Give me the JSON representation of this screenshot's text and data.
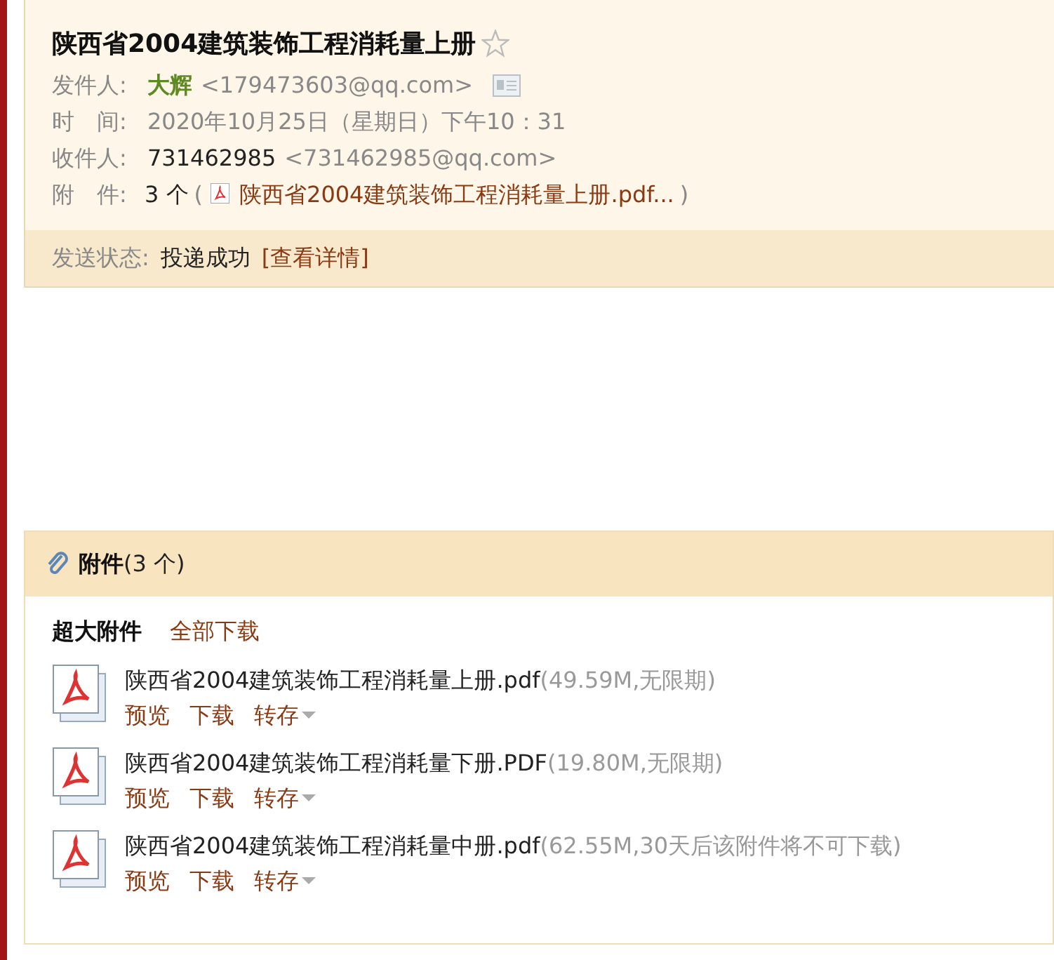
{
  "header": {
    "subject": "陕西省2004建筑装饰工程消耗量上册",
    "fields": [
      {
        "kind": "sender",
        "label": "发件人:",
        "name": "大辉",
        "address": "<179473603@qq.com>"
      },
      {
        "kind": "plain",
        "label": "时　间:",
        "value": "2020年10月25日（星期日）下午10：31"
      },
      {
        "kind": "recipient",
        "label": "收件人:",
        "name": "731462985",
        "address": "<731462985@qq.com>"
      },
      {
        "kind": "attachment",
        "label": "附　件:",
        "count": "3 个",
        "open": "(",
        "file": "陕西省2004建筑装饰工程消耗量上册.pdf...",
        "close": ")"
      }
    ],
    "status": {
      "label": "发送状态:",
      "value": "投递成功",
      "link": "[查看详情]"
    }
  },
  "attachments": {
    "title": "附件",
    "count": "(3 个)",
    "group": "超大附件",
    "download_all": "全部下载",
    "files": [
      {
        "name": "陕西省2004建筑装饰工程消耗量上册.pdf",
        "info": "(49.59M,无限期)",
        "actions": [
          "预览",
          "下载",
          "转存"
        ]
      },
      {
        "name": "陕西省2004建筑装饰工程消耗量下册.PDF",
        "info": "(19.80M,无限期)",
        "actions": [
          "预览",
          "下载",
          "转存"
        ]
      },
      {
        "name": "陕西省2004建筑装饰工程消耗量中册.pdf",
        "info": "(62.55M,30天后该附件将不可下载)",
        "actions": [
          "预览",
          "下载",
          "转存"
        ]
      }
    ]
  }
}
